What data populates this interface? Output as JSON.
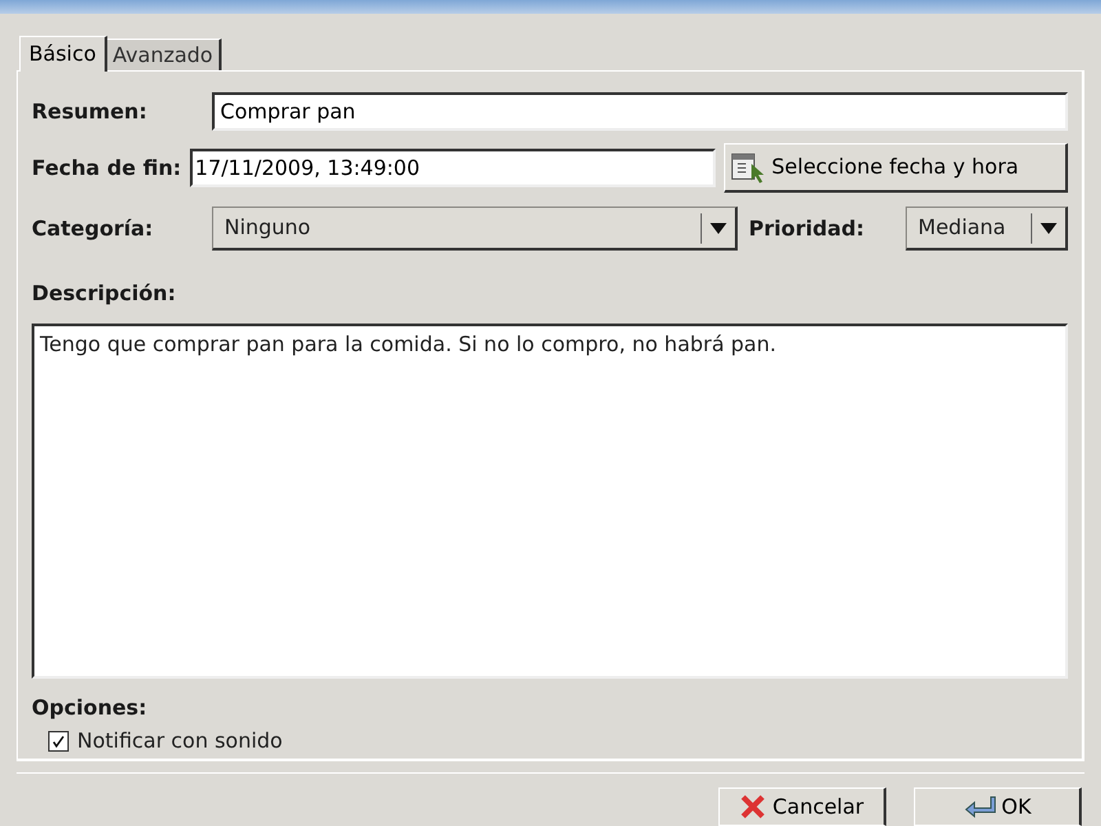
{
  "tabs": [
    {
      "label": "Básico",
      "selected": true
    },
    {
      "label": "Avanzado",
      "selected": false
    }
  ],
  "summary": {
    "label": "Resumen:",
    "value": "Comprar pan"
  },
  "end_date": {
    "label": "Fecha de fin:",
    "value": "17/11/2009, 13:49:00",
    "button": "Seleccione fecha y hora"
  },
  "category": {
    "label": "Categoría:",
    "value": "Ninguno"
  },
  "priority": {
    "label": "Prioridad:",
    "value": "Mediana"
  },
  "description": {
    "label": "Descripción:",
    "value": "Tengo que comprar pan para la comida. Si no lo compro, no habrá pan."
  },
  "options": {
    "label": "Opciones:",
    "items": [
      {
        "label": "Notificar con sonido",
        "checked": true
      }
    ]
  },
  "buttons": [
    {
      "label": "Cancelar",
      "kind": "cancel"
    },
    {
      "label": "OK",
      "kind": "ok"
    }
  ]
}
